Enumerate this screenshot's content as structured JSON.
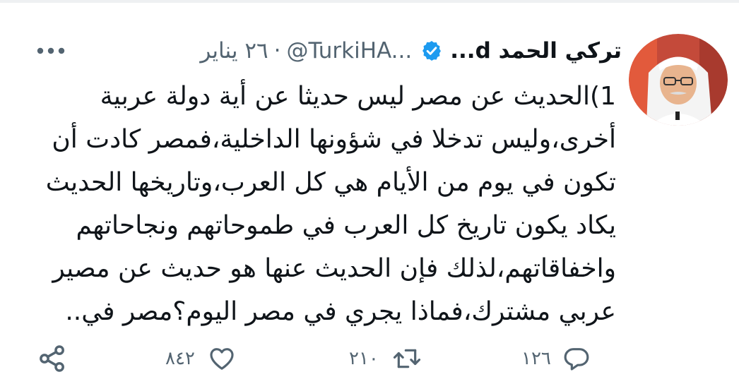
{
  "tweet": {
    "author": {
      "display_name": "تركي الحمد d...",
      "handle": "@TurkiHA...",
      "verified": true,
      "avatar_icon": "user-avatar"
    },
    "separator": "·",
    "date": "٢٦ يناير",
    "more_icon": "more-icon",
    "text_lines": [
      "1)الحديث عن مصر ليس حديثا عن أية دولة عربية",
      "أخرى،وليس تدخلا في شؤونها الداخلية،فمصر كادت أن",
      "تكون في يوم من الأيام هي كل العرب،وتاريخها الحديث",
      "يكاد يكون تاريخ كل العرب في طموحاتهم ونجاحاتهم",
      "واخفاقاتهم،لذلك فإن الحديث عنها هو حديث عن مصير",
      "عربي مشترك،فماذا يجري في مصر اليوم؟مصر في.."
    ],
    "actions": {
      "reply_count": "١٢٦",
      "retweet_count": "٢١٠",
      "like_count": "٨٤٢",
      "share_icon": "share-icon"
    },
    "colors": {
      "text": "#0f1419",
      "secondary": "#536471",
      "verified": "#1d9bf0"
    }
  }
}
